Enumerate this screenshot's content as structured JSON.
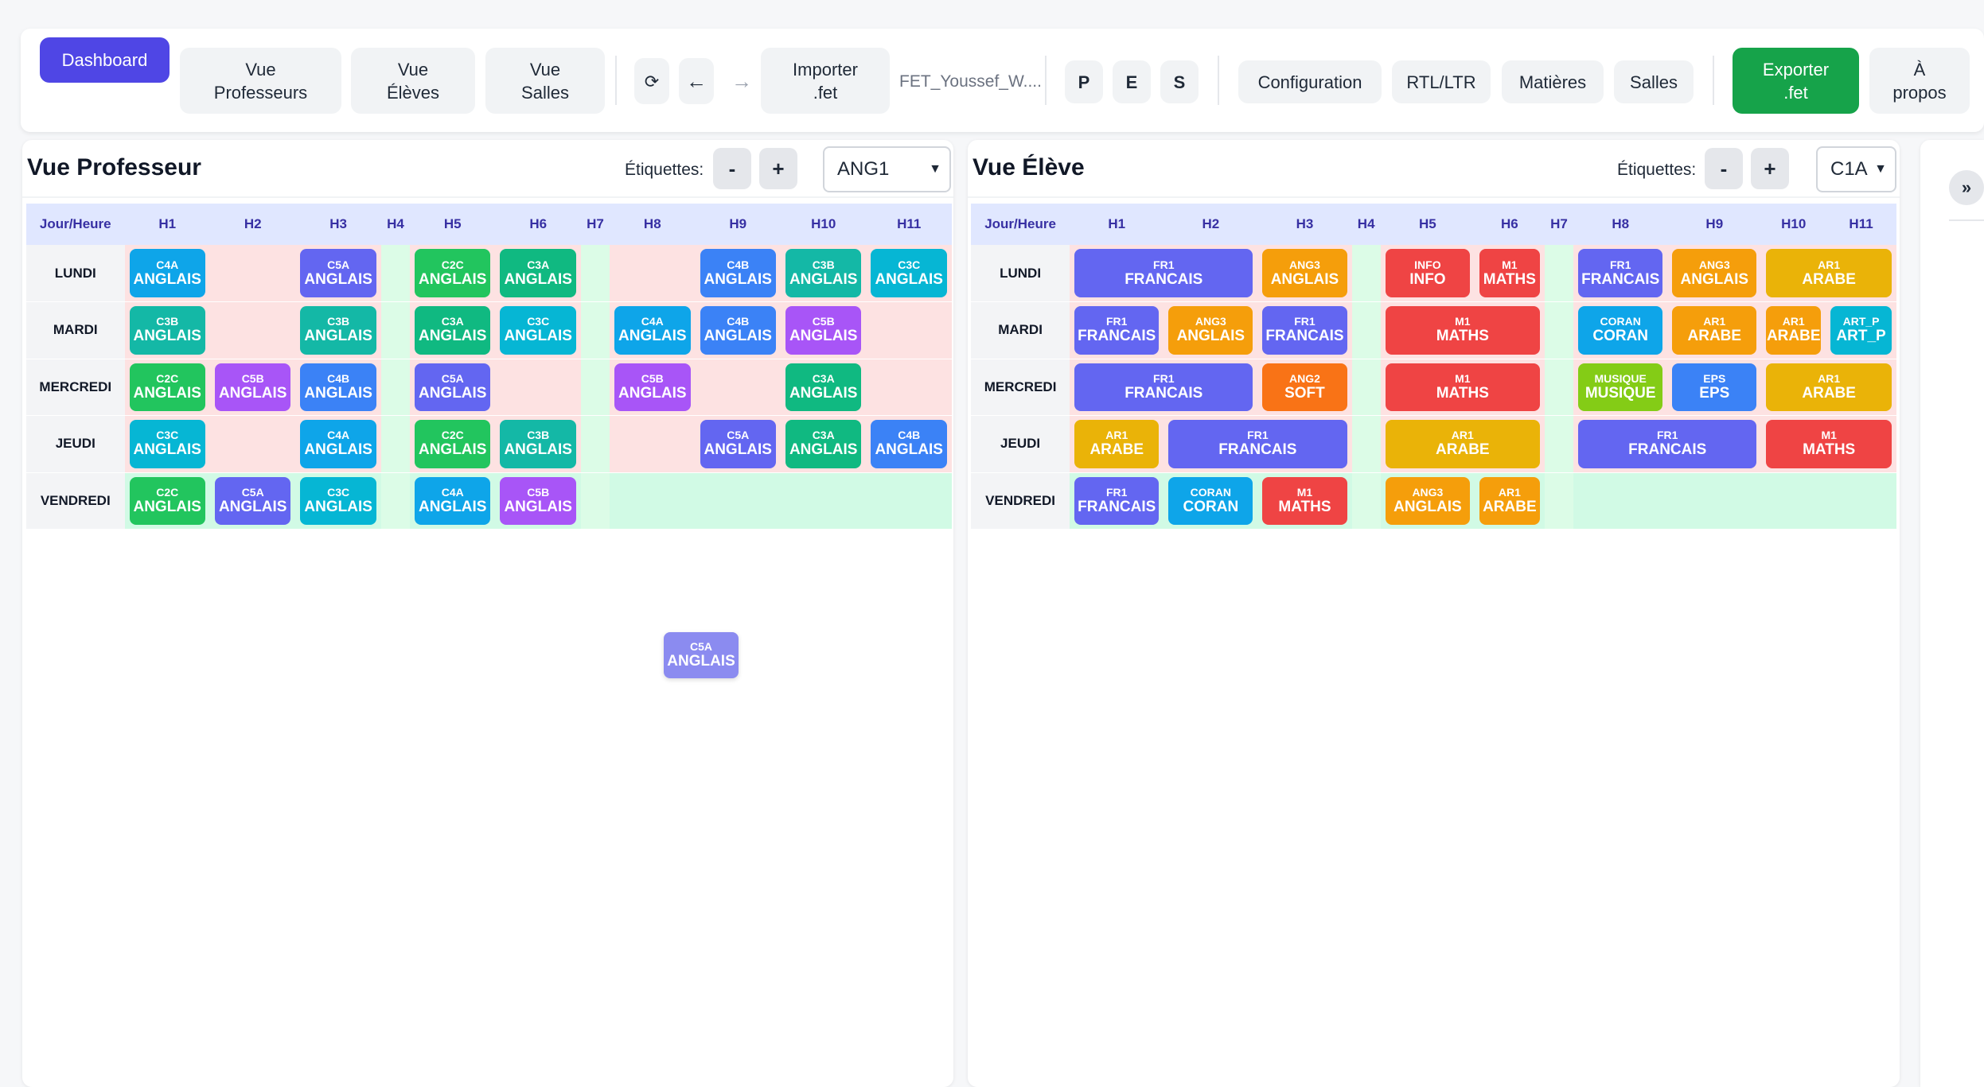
{
  "toolbar": {
    "dashboard": "Dashboard",
    "vue_professeurs": "Vue\nProfesseurs",
    "vue_eleves": "Vue\nÉlèves",
    "vue_salles": "Vue\nSalles",
    "refresh": "⟳",
    "undo": "←",
    "redo": "→",
    "importer": "Importer\n.fet",
    "filename": "FET_Youssef_W....",
    "p": "P",
    "e": "E",
    "s": "S",
    "configuration": "Configuration",
    "rtl_ltr": "RTL/LTR",
    "matieres": "Matières",
    "salles": "Salles",
    "exporter": "Exporter\n.fet",
    "a_propos": "À\npropos"
  },
  "colors": {
    "accent": "#4f46e5",
    "export": "#16a34a"
  },
  "hours": [
    "H1",
    "H2",
    "H3",
    "H4",
    "H5",
    "H6",
    "H7",
    "H8",
    "H9",
    "H10",
    "H11"
  ],
  "days": [
    "LUNDI",
    "MARDI",
    "MERCREDI",
    "JEUDI",
    "VENDREDI"
  ],
  "corner": "Jour/Heure",
  "etiquettes_label": "Étiquettes:",
  "minus": "-",
  "plus": "+",
  "prof": {
    "title": "Vue Professeur",
    "selected": "ANG1",
    "cards": [
      [
        "C4A",
        "ANGLAIS"
      ],
      [
        "C5A",
        "ANGLAIS"
      ],
      [
        "C2C",
        "ANGLAIS"
      ],
      [
        "C3A",
        "ANGLAIS"
      ],
      [
        "C4B",
        "ANGLAIS"
      ],
      [
        "C3B",
        "ANGLAIS"
      ],
      [
        "C3C",
        "ANGLAIS"
      ],
      [
        "C3B",
        "ANGLAIS"
      ],
      [
        "C3B",
        "ANGLAIS"
      ],
      [
        "C3A",
        "ANGLAIS"
      ],
      [
        "C3C",
        "ANGLAIS"
      ],
      [
        "C4A",
        "ANGLAIS"
      ],
      [
        "C4B",
        "ANGLAIS"
      ],
      [
        "C5B",
        "ANGLAIS"
      ],
      [
        "C2C",
        "ANGLAIS"
      ],
      [
        "C5B",
        "ANGLAIS"
      ],
      [
        "C4B",
        "ANGLAIS"
      ],
      [
        "C5A",
        "ANGLAIS"
      ],
      [
        "C5B",
        "ANGLAIS"
      ],
      [
        "C3A",
        "ANGLAIS"
      ],
      [
        "C3C",
        "ANGLAIS"
      ],
      [
        "C4A",
        "ANGLAIS"
      ],
      [
        "C2C",
        "ANGLAIS"
      ],
      [
        "C3B",
        "ANGLAIS"
      ],
      [
        "C5A",
        "ANGLAIS"
      ],
      [
        "C3A",
        "ANGLAIS"
      ],
      [
        "C4B",
        "ANGLAIS"
      ],
      [
        "C2C",
        "ANGLAIS"
      ],
      [
        "C5A",
        "ANGLAIS"
      ],
      [
        "C3C",
        "ANGLAIS"
      ],
      [
        "C4A",
        "ANGLAIS"
      ],
      [
        "C5B",
        "ANGLAIS"
      ]
    ],
    "drag": [
      "C5A",
      "ANGLAIS"
    ]
  },
  "eleve": {
    "title": "Vue Élève",
    "selected": "C1A",
    "cards": [
      [
        "FR1",
        "FRANCAIS"
      ],
      [
        "ANG3",
        "ANGLAIS"
      ],
      [
        "INFO",
        "INFO"
      ],
      [
        "M1",
        "MATHS"
      ],
      [
        "FR1",
        "FRANCAIS"
      ],
      [
        "ANG3",
        "ANGLAIS"
      ],
      [
        "AR1",
        "ARABE"
      ],
      [
        "FR1",
        "FRANCAIS"
      ],
      [
        "ANG3",
        "ANGLAIS"
      ],
      [
        "FR1",
        "FRANCAIS"
      ],
      [
        "M1",
        "MATHS"
      ],
      [
        "CORAN",
        "CORAN"
      ],
      [
        "AR1",
        "ARABE"
      ],
      [
        "AR1",
        "ARABE"
      ],
      [
        "ART_P",
        "ART_P"
      ],
      [
        "FR1",
        "FRANCAIS"
      ],
      [
        "ANG2",
        "SOFT"
      ],
      [
        "M1",
        "MATHS"
      ],
      [
        "MUSIQUE",
        "MUSIQUE"
      ],
      [
        "EPS",
        "EPS"
      ],
      [
        "AR1",
        "ARABE"
      ],
      [
        "AR1",
        "ARABE"
      ],
      [
        "FR1",
        "FRANCAIS"
      ],
      [
        "AR1",
        "ARABE"
      ],
      [
        "FR1",
        "FRANCAIS"
      ],
      [
        "M1",
        "MATHS"
      ],
      [
        "FR1",
        "FRANCAIS"
      ],
      [
        "CORAN",
        "CORAN"
      ],
      [
        "M1",
        "MATHS"
      ],
      [
        "ANG3",
        "ANGLAIS"
      ],
      [
        "AR1",
        "ARABE"
      ]
    ]
  },
  "collapse": "»"
}
